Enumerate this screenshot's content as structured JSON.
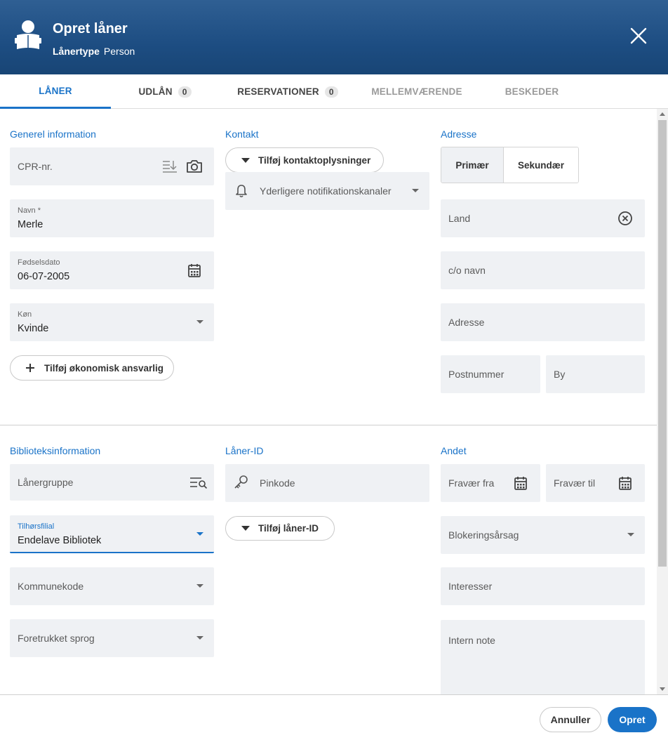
{
  "header": {
    "title": "Opret låner",
    "subtitle_label": "Lånertype",
    "subtitle_value": "Person",
    "icon": "reader-icon",
    "close_icon": "close-icon"
  },
  "tabs": [
    {
      "label": "LÅNER",
      "state": "active"
    },
    {
      "label": "UDLÅN",
      "count": "0",
      "state": "normal"
    },
    {
      "label": "RESERVATIONER",
      "count": "0",
      "state": "normal"
    },
    {
      "label": "MELLEMVÆRENDE",
      "state": "disabled"
    },
    {
      "label": "BESKEDER",
      "state": "disabled"
    }
  ],
  "general": {
    "title": "Generel information",
    "cpr": {
      "placeholder": "CPR-nr."
    },
    "name": {
      "label": "Navn *",
      "value": "Merle"
    },
    "birthdate": {
      "label": "Fødselsdato",
      "value": "06-07-2005"
    },
    "gender": {
      "label": "Køn",
      "value": "Kvinde"
    },
    "add_financial": "Tilføj økonomisk ansvarlig"
  },
  "contact": {
    "title": "Kontakt",
    "add_contact": "Tilføj kontaktoplysninger",
    "notifications": "Yderligere notifikationskanaler"
  },
  "address": {
    "title": "Adresse",
    "primary": "Primær",
    "secondary": "Sekundær",
    "country": "Land",
    "co_name": "c/o navn",
    "address": "Adresse",
    "postcode": "Postnummer",
    "city": "By"
  },
  "library": {
    "title": "Biblioteksinformation",
    "group": "Lånergruppe",
    "branch": {
      "label": "Tilhørsfilial",
      "value": "Endelave Bibliotek"
    },
    "municipality": "Kommunekode",
    "language": "Foretrukket sprog"
  },
  "borrower_id": {
    "title": "Låner-ID",
    "pin": "Pinkode",
    "add_id": "Tilføj låner-ID"
  },
  "other": {
    "title": "Andet",
    "absent_from": "Fravær fra",
    "absent_to": "Fravær til",
    "block_reason": "Blokeringsårsag",
    "interests": "Interesser",
    "internal_note": "Intern note"
  },
  "footer": {
    "cancel": "Annuller",
    "create": "Opret"
  },
  "colors": {
    "accent": "#1a73c8",
    "header": "#1d4d82",
    "field_bg": "#eff1f4"
  }
}
